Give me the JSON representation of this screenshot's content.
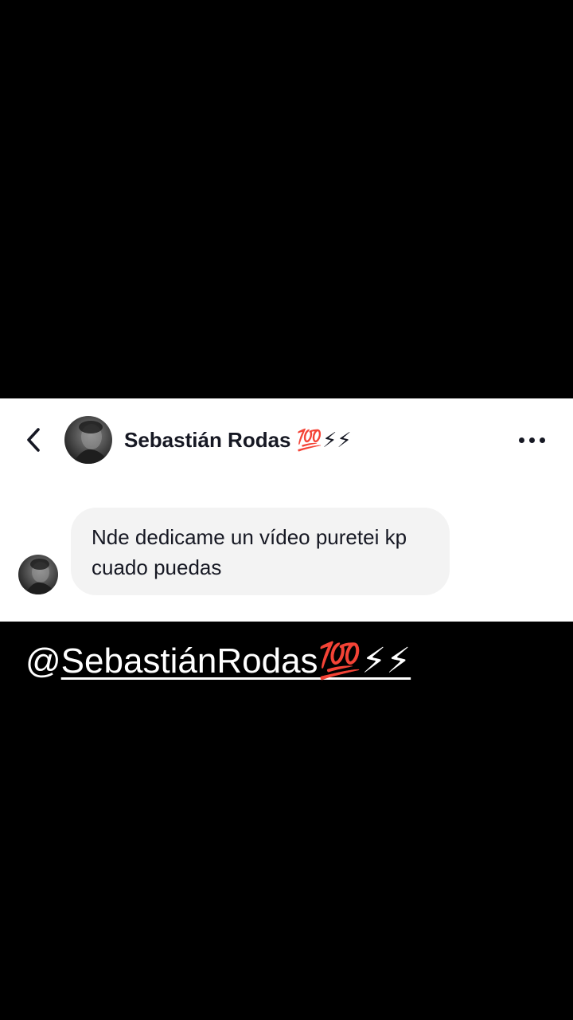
{
  "chat": {
    "contact_name": "Sebastián Rodas 💯⚡⚡",
    "messages": [
      {
        "text": "Nde dedicame un vídeo puretei kp cuado puedas",
        "sender": "contact"
      }
    ]
  },
  "caption": {
    "at": "@",
    "mention": "SebastiánRodas💯⚡⚡"
  },
  "icons": {
    "back": "chevron-left-icon",
    "more": "more-horizontal-icon"
  },
  "colors": {
    "background": "#000000",
    "card": "#ffffff",
    "bubble": "#f3f3f3",
    "text": "#161823",
    "caption": "#ffffff"
  }
}
